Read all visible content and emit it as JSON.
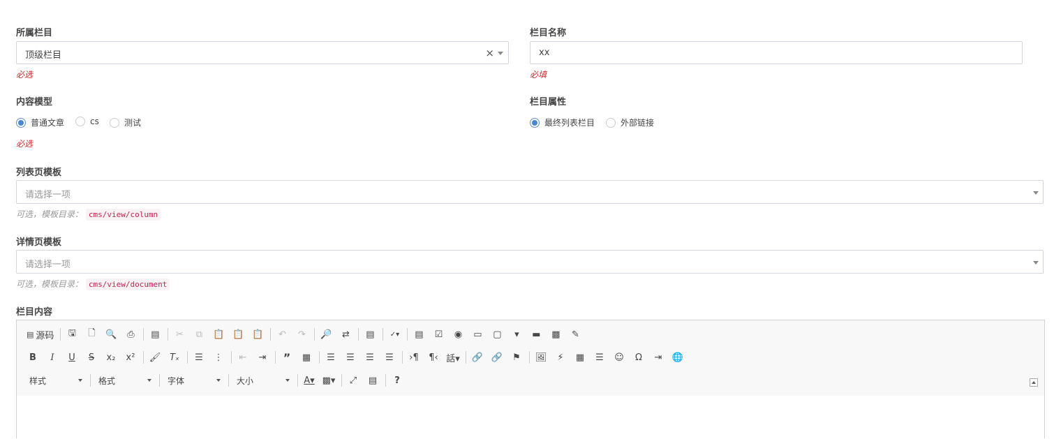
{
  "parent_column": {
    "label": "所属栏目",
    "value": "顶级栏目",
    "clear_icon": "×",
    "help": "必选"
  },
  "column_name": {
    "label": "栏目名称",
    "value": "xx",
    "help": "必填"
  },
  "content_model": {
    "label": "内容模型",
    "options": [
      {
        "label": "普通文章",
        "selected": true
      },
      {
        "label": "cs",
        "selected": false
      },
      {
        "label": "测试",
        "selected": false
      }
    ],
    "help": "必选"
  },
  "column_attribute": {
    "label": "栏目属性",
    "options": [
      {
        "label": "最终列表栏目",
        "selected": true
      },
      {
        "label": "外部链接",
        "selected": false
      }
    ]
  },
  "list_template": {
    "label": "列表页模板",
    "placeholder": "请选择一项",
    "help_prefix": "可选，模板目录：",
    "help_code": "cms/view/column"
  },
  "detail_template": {
    "label": "详情页模板",
    "placeholder": "请选择一项",
    "help_prefix": "可选，模板目录：",
    "help_code": "cms/view/document"
  },
  "column_content": {
    "label": "栏目内容",
    "toolbar": {
      "source_label": "源码",
      "combos": [
        "样式",
        "格式",
        "字体",
        "大小"
      ]
    }
  },
  "colors": {
    "accent": "#4a86d8",
    "error": "#c9302c",
    "code": "#c7254e"
  }
}
